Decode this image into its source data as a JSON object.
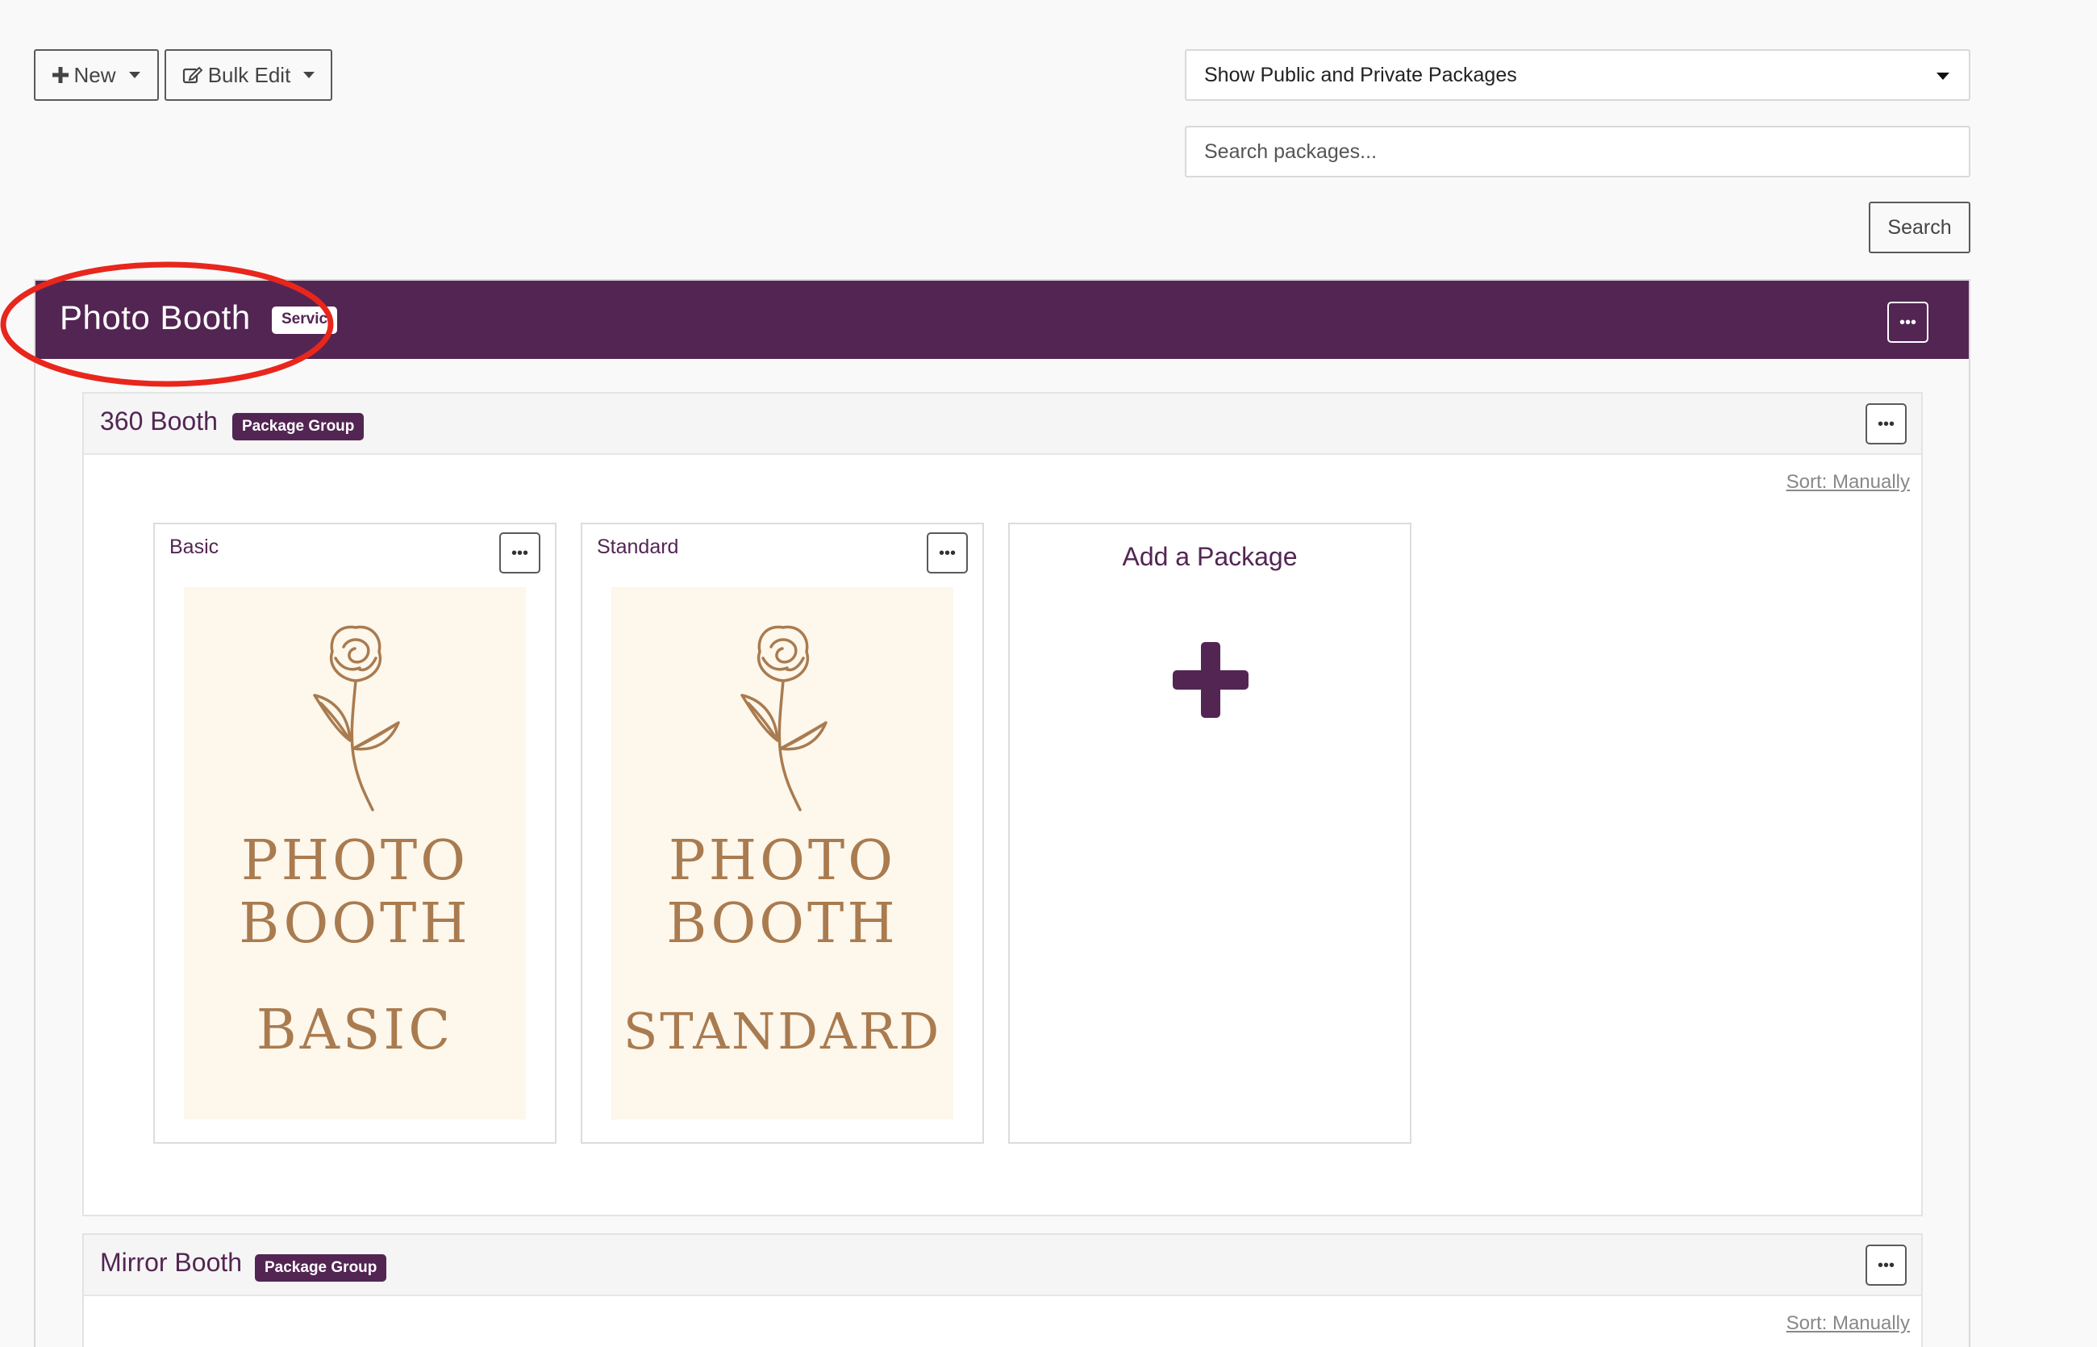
{
  "toolbar": {
    "new_label": "New",
    "bulk_edit_label": "Bulk Edit",
    "visibility_select": "Show Public and Private Packages",
    "search_placeholder": "Search packages...",
    "search_label": "Search"
  },
  "service": {
    "title": "Photo Booth",
    "badge": "Servic",
    "menu": "•••"
  },
  "groups": [
    {
      "title": "360 Booth",
      "badge": "Package Group",
      "menu": "•••",
      "sort_label": "Sort: Manually",
      "packages": [
        {
          "title": "Basic",
          "menu": "•••",
          "poster": [
            "PHOTO",
            "BOOTH",
            "BASIC"
          ]
        },
        {
          "title": "Standard",
          "menu": "•••",
          "poster": [
            "PHOTO",
            "BOOTH",
            "STANDARD"
          ]
        }
      ],
      "add_package_label": "Add a Package"
    },
    {
      "title": "Mirror Booth",
      "badge": "Package Group",
      "menu": "•••",
      "sort_label": "Sort: Manually"
    }
  ],
  "colors": {
    "brand_purple": "#532553",
    "poster_bg": "#fdf7ec",
    "poster_gold": "#a97b4f",
    "highlight_circle": "#e8261c"
  },
  "icons": {
    "new": "plus-icon",
    "bulk_edit": "edit-icon",
    "menu": "ellipsis-icon",
    "add": "plus-icon"
  }
}
